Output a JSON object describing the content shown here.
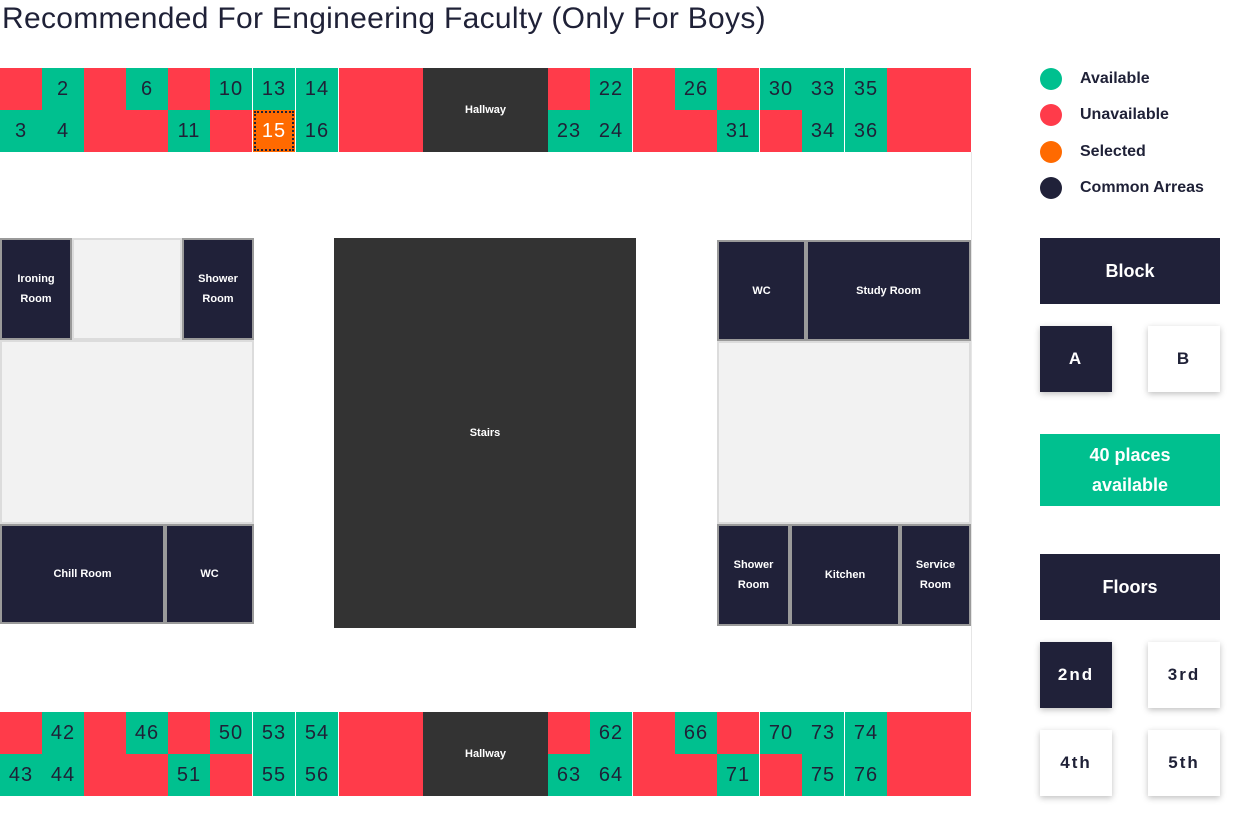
{
  "title": "Recommended For Engineering Faculty (Only For Boys)",
  "colors": {
    "available": "#00c08f",
    "unavailable": "#ff3b4a",
    "selected": "#ff6a00",
    "common": "#202139"
  },
  "legend": [
    {
      "label": "Available",
      "color": "#00c08f"
    },
    {
      "label": "Unavailable",
      "color": "#ff3b4a"
    },
    {
      "label": "Selected",
      "color": "#ff6a00"
    },
    {
      "label": "Common Arreas",
      "color": "#202139"
    }
  ],
  "top_block": {
    "hallway_label": "Hallway",
    "seats": [
      {
        "label": "",
        "status": "unavailable"
      },
      {
        "label": "2",
        "status": "available"
      },
      {
        "label": "",
        "status": "unavailable"
      },
      {
        "label": "6",
        "status": "available"
      },
      {
        "label": "",
        "status": "unavailable"
      },
      {
        "label": "10",
        "status": "available"
      },
      {
        "label": "13",
        "status": "available"
      },
      {
        "label": "14",
        "status": "available"
      },
      {
        "label": "3",
        "status": "available"
      },
      {
        "label": "4",
        "status": "available"
      },
      {
        "label": "",
        "status": "unavailable"
      },
      {
        "label": "",
        "status": "unavailable"
      },
      {
        "label": "11",
        "status": "available"
      },
      {
        "label": "",
        "status": "unavailable"
      },
      {
        "label": "15",
        "status": "selected"
      },
      {
        "label": "16",
        "status": "available"
      },
      {
        "label": "",
        "status": "unavailable"
      },
      {
        "label": "22",
        "status": "available"
      },
      {
        "label": "",
        "status": "unavailable"
      },
      {
        "label": "26",
        "status": "available"
      },
      {
        "label": "",
        "status": "unavailable"
      },
      {
        "label": "30",
        "status": "available"
      },
      {
        "label": "33",
        "status": "available"
      },
      {
        "label": "35",
        "status": "available"
      },
      {
        "label": "23",
        "status": "available"
      },
      {
        "label": "24",
        "status": "available"
      },
      {
        "label": "",
        "status": "unavailable"
      },
      {
        "label": "",
        "status": "unavailable"
      },
      {
        "label": "31",
        "status": "available"
      },
      {
        "label": "",
        "status": "unavailable"
      },
      {
        "label": "34",
        "status": "available"
      },
      {
        "label": "36",
        "status": "available"
      }
    ]
  },
  "bottom_block": {
    "hallway_label": "Hallway",
    "seats": [
      {
        "label": "",
        "status": "unavailable"
      },
      {
        "label": "42",
        "status": "available"
      },
      {
        "label": "",
        "status": "unavailable"
      },
      {
        "label": "46",
        "status": "available"
      },
      {
        "label": "",
        "status": "unavailable"
      },
      {
        "label": "50",
        "status": "available"
      },
      {
        "label": "53",
        "status": "available"
      },
      {
        "label": "54",
        "status": "available"
      },
      {
        "label": "43",
        "status": "available"
      },
      {
        "label": "44",
        "status": "available"
      },
      {
        "label": "",
        "status": "unavailable"
      },
      {
        "label": "",
        "status": "unavailable"
      },
      {
        "label": "51",
        "status": "available"
      },
      {
        "label": "",
        "status": "unavailable"
      },
      {
        "label": "55",
        "status": "available"
      },
      {
        "label": "56",
        "status": "available"
      },
      {
        "label": "",
        "status": "unavailable"
      },
      {
        "label": "62",
        "status": "available"
      },
      {
        "label": "",
        "status": "unavailable"
      },
      {
        "label": "66",
        "status": "available"
      },
      {
        "label": "",
        "status": "unavailable"
      },
      {
        "label": "70",
        "status": "available"
      },
      {
        "label": "73",
        "status": "available"
      },
      {
        "label": "74",
        "status": "available"
      },
      {
        "label": "63",
        "status": "available"
      },
      {
        "label": "64",
        "status": "available"
      },
      {
        "label": "",
        "status": "unavailable"
      },
      {
        "label": "",
        "status": "unavailable"
      },
      {
        "label": "71",
        "status": "available"
      },
      {
        "label": "",
        "status": "unavailable"
      },
      {
        "label": "75",
        "status": "available"
      },
      {
        "label": "76",
        "status": "available"
      }
    ]
  },
  "rooms": {
    "ironing": "Ironing\nRoom",
    "shower_left": "Shower\nRoom",
    "chill": "Chill Room",
    "wc_left": "WC",
    "stairs": "Stairs",
    "wc_right": "WC",
    "study": "Study Room",
    "shower_right": "Shower\nRoom",
    "kitchen": "Kitchen",
    "service": "Service\nRoom"
  },
  "block_panel": {
    "heading": "Block",
    "options": [
      {
        "label": "A",
        "active": true
      },
      {
        "label": "B",
        "active": false
      }
    ]
  },
  "places_available": "40 places\navailable",
  "floors_panel": {
    "heading": "Floors",
    "options": [
      {
        "label": "2nd",
        "active": true
      },
      {
        "label": "3rd",
        "active": false
      },
      {
        "label": "4th",
        "active": false
      },
      {
        "label": "5th",
        "active": false
      }
    ]
  }
}
